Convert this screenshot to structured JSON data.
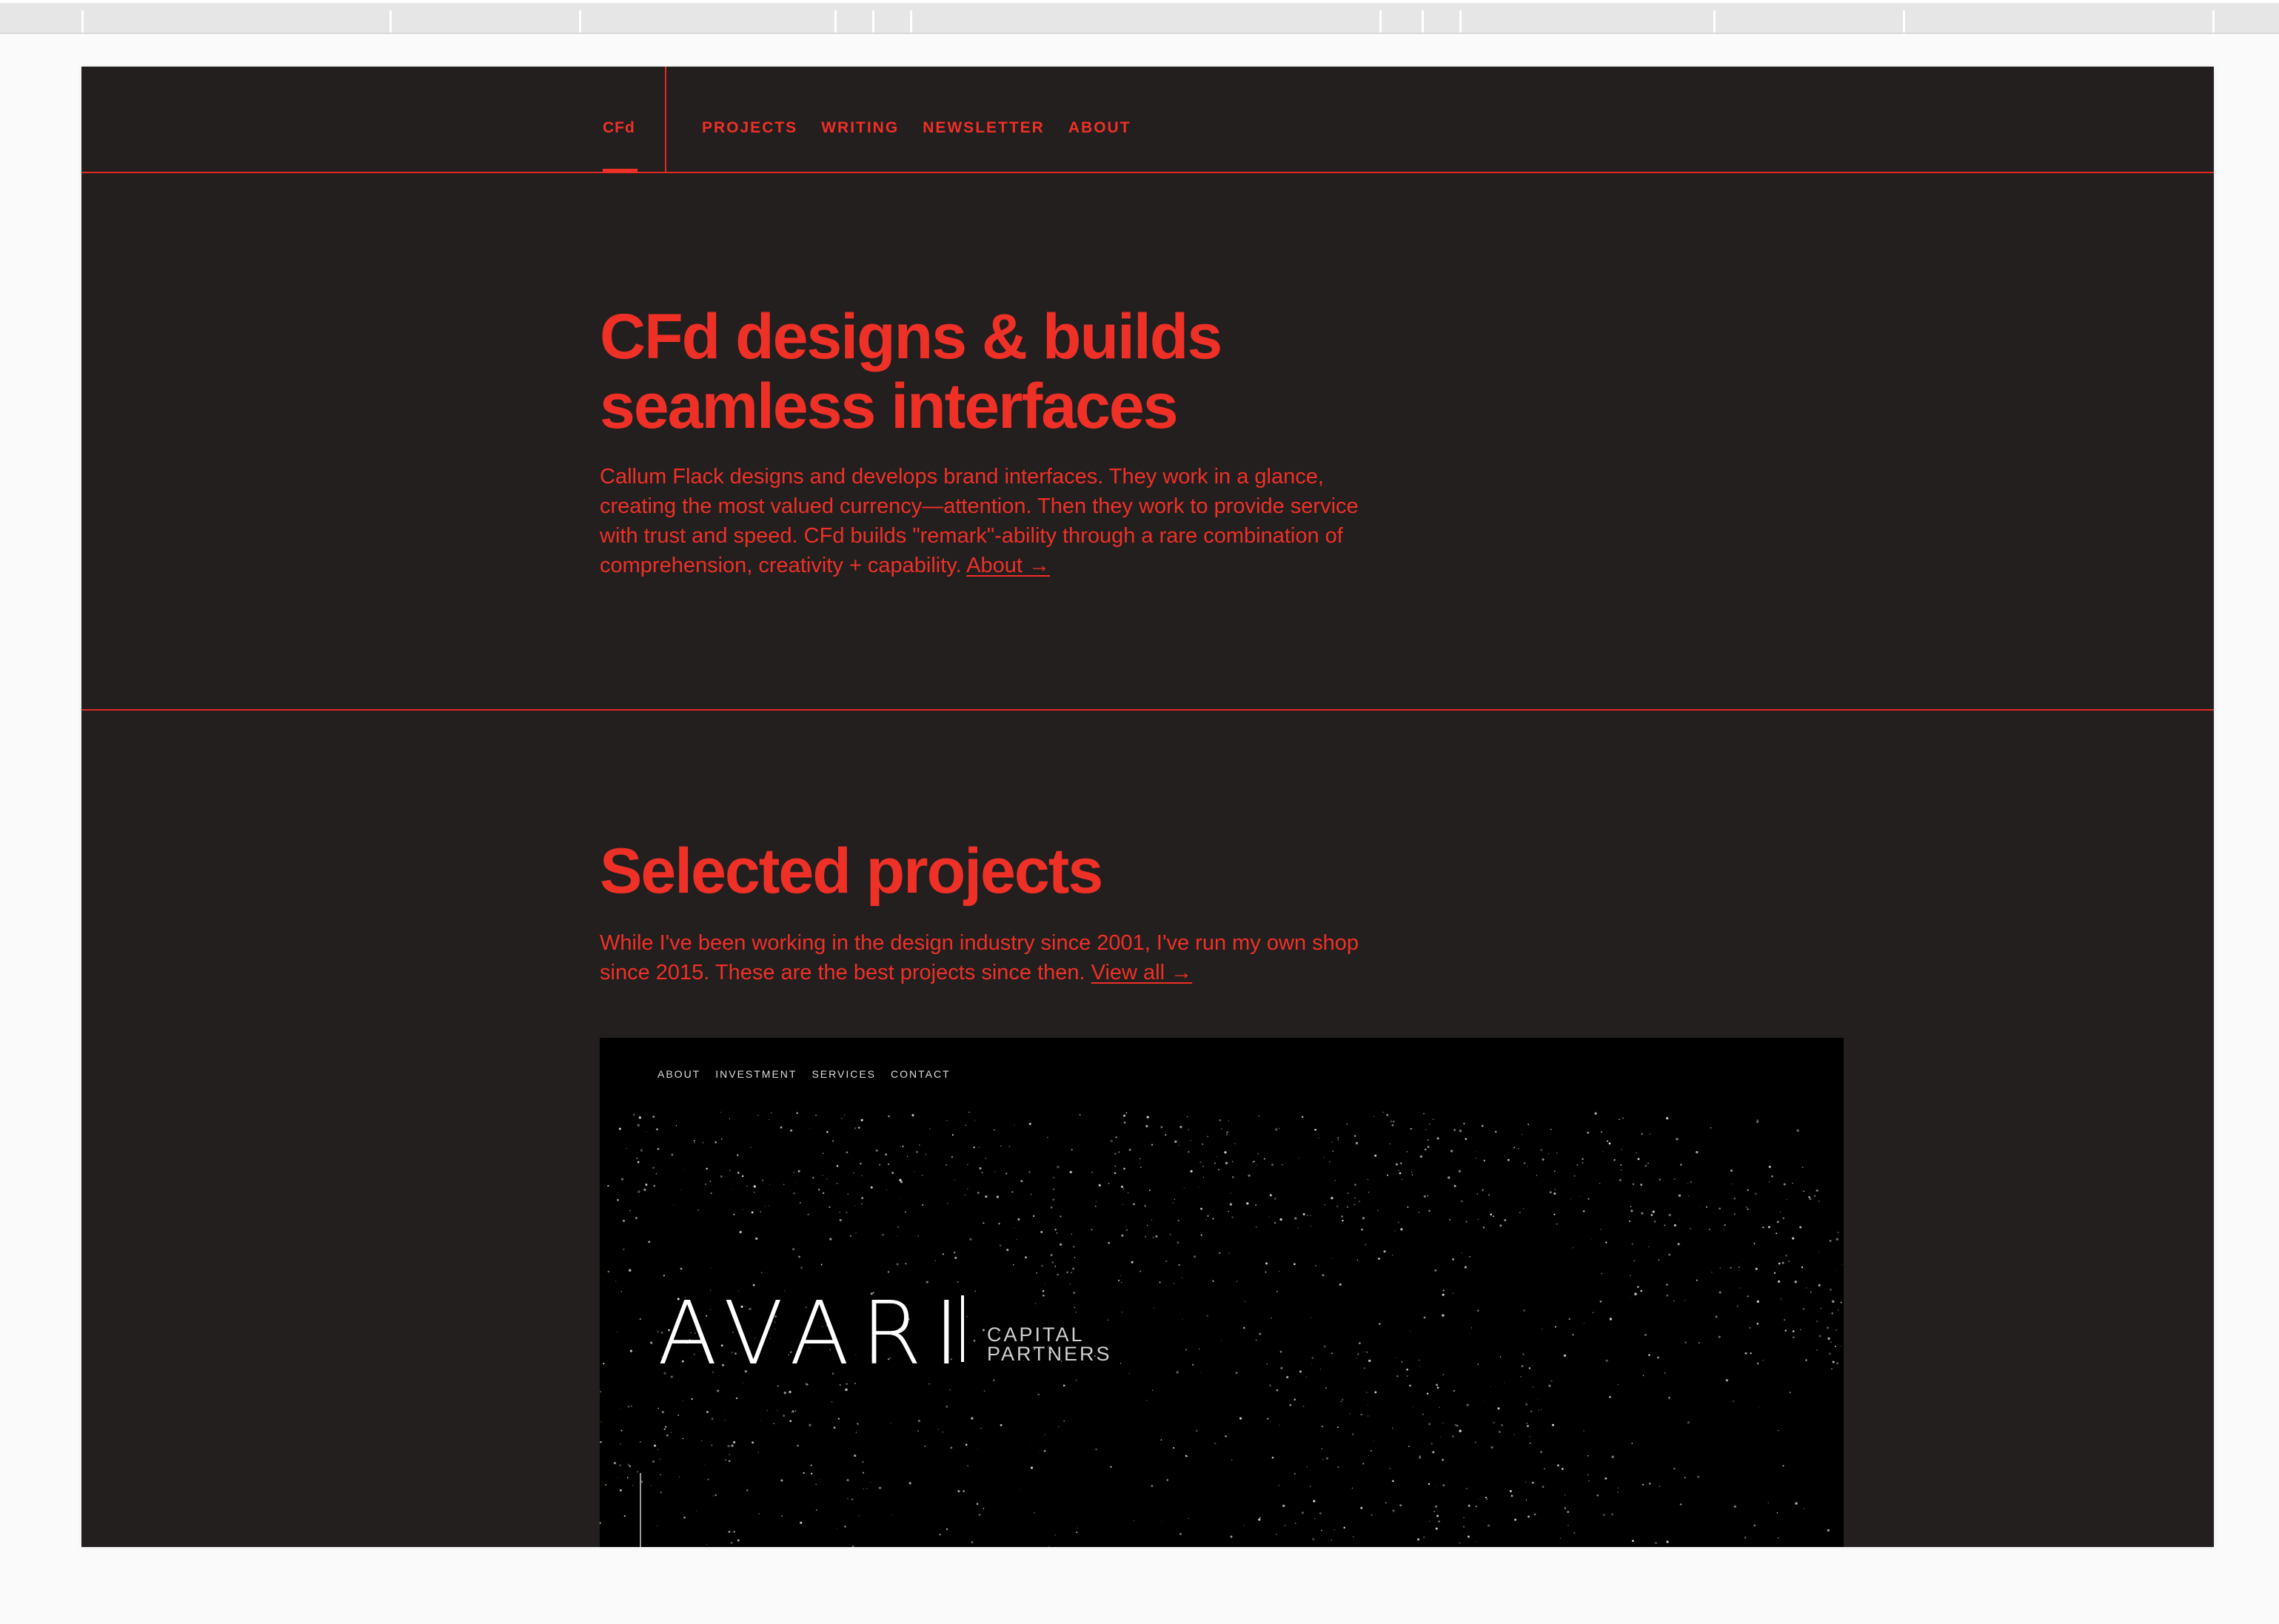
{
  "nav": {
    "brand": "CFd",
    "links": [
      "PROJECTS",
      "WRITING",
      "NEWSLETTER",
      "ABOUT"
    ]
  },
  "hero": {
    "title_line1": "CFd designs & builds",
    "title_line2": "seamless interfaces",
    "body": "Callum Flack designs and develops brand interfaces. They work in a glance, creating the most valued currency—attention. Then they work to provide service with trust and speed. CFd builds \"remark\"-ability through a rare combination of comprehension, creativity + capability.",
    "link": "About →"
  },
  "projects": {
    "title": "Selected projects",
    "body": "While I've been working in the design industry since 2001, I've run my own shop since 2015. These are the best projects since then.",
    "link": "View all →",
    "preview": {
      "nav": [
        "ABOUT",
        "INVESTMENT",
        "SERVICES",
        "CONTACT"
      ],
      "logo": "AVARI",
      "sub1": "CAPITAL",
      "sub2": "PARTNERS"
    }
  },
  "colors": {
    "accent": "#ef3027",
    "background": "#231f1f",
    "preview_bg": "#000000"
  }
}
